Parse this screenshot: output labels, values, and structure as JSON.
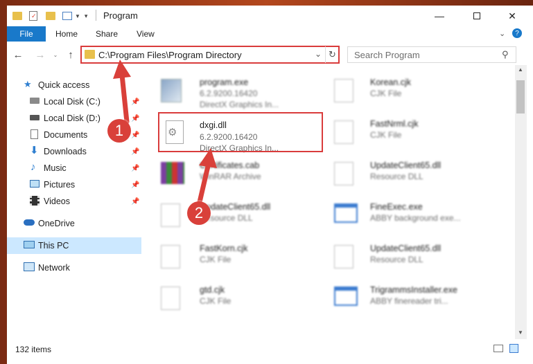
{
  "window": {
    "title": "Program"
  },
  "ribbon": {
    "file": "File",
    "tabs": [
      "Home",
      "Share",
      "View"
    ]
  },
  "address": {
    "path": "C:\\Program Files\\Program Directory"
  },
  "search": {
    "placeholder": "Search Program"
  },
  "nav": {
    "quick_access": "Quick access",
    "items": [
      "Local Disk (C:)",
      "Local Disk (D:)",
      "Documents",
      "Downloads",
      "Music",
      "Pictures",
      "Videos"
    ],
    "onedrive": "OneDrive",
    "this_pc": "This PC",
    "network": "Network"
  },
  "files": {
    "col1": [
      {
        "name": "program.exe",
        "meta1": "6.2.9200.16420",
        "meta2": "DirectX Graphics In..."
      },
      {
        "name": "dxgi.dll",
        "meta1": "6.2.9200.16420",
        "meta2": "DirectX Graphics In..."
      },
      {
        "name": "Certificates.cab",
        "meta1": "WinRAR Archive",
        "meta2": ""
      },
      {
        "name": "UpdateClient65.dll",
        "meta1": "Resource DLL",
        "meta2": ""
      },
      {
        "name": "FastKorn.cjk",
        "meta1": "CJK File",
        "meta2": ""
      },
      {
        "name": "gtd.cjk",
        "meta1": "CJK File",
        "meta2": ""
      }
    ],
    "col2": [
      {
        "name": "Korean.cjk",
        "meta1": "CJK File"
      },
      {
        "name": "FastNrml.cjk",
        "meta1": "CJK File"
      },
      {
        "name": "UpdateClient65.dll",
        "meta1": "Resource DLL"
      },
      {
        "name": "FineExec.exe",
        "meta1": "ABBY background exe..."
      },
      {
        "name": "UpdateClient65.dll",
        "meta1": "Resource DLL"
      },
      {
        "name": "TrigrammsInstaller.exe",
        "meta1": "ABBY finereader tri..."
      }
    ]
  },
  "status": {
    "count": "132 items"
  },
  "annotations": {
    "badge1": "1",
    "badge2": "2",
    "color": "#d9403a"
  }
}
